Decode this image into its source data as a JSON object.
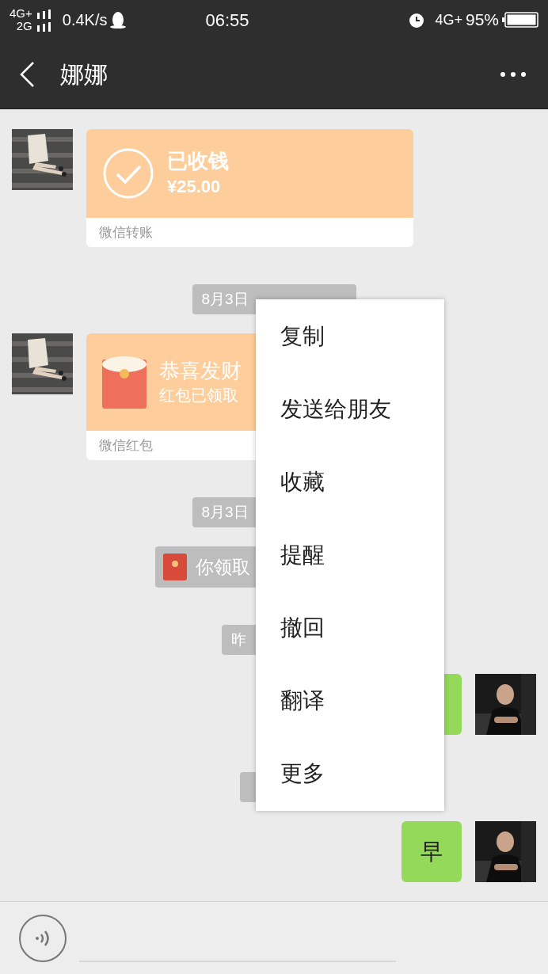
{
  "status_bar": {
    "network_1": "4G+",
    "network_2": "2G",
    "speed": "0.4K/s",
    "time": "06:55",
    "network_3": "4G+",
    "battery": "95%"
  },
  "header": {
    "title": "娜娜"
  },
  "messages": [
    {
      "kind": "transfer",
      "title": "已收钱",
      "amount": "¥25.00",
      "footer": "微信转账"
    },
    {
      "kind": "time",
      "text": "8月3日"
    },
    {
      "kind": "redpacket",
      "title": "恭喜发财",
      "subtitle": "红包已领取",
      "footer": "微信红包"
    },
    {
      "kind": "time",
      "text": "8月3日"
    },
    {
      "kind": "notice",
      "text": "你领取"
    },
    {
      "kind": "time",
      "text": "昨"
    },
    {
      "kind": "text"
    },
    {
      "kind": "time"
    },
    {
      "kind": "text",
      "text": "早"
    }
  ],
  "context_menu": {
    "items": [
      "复制",
      "发送给朋友",
      "收藏",
      "提醒",
      "撤回",
      "翻译",
      "更多"
    ]
  }
}
